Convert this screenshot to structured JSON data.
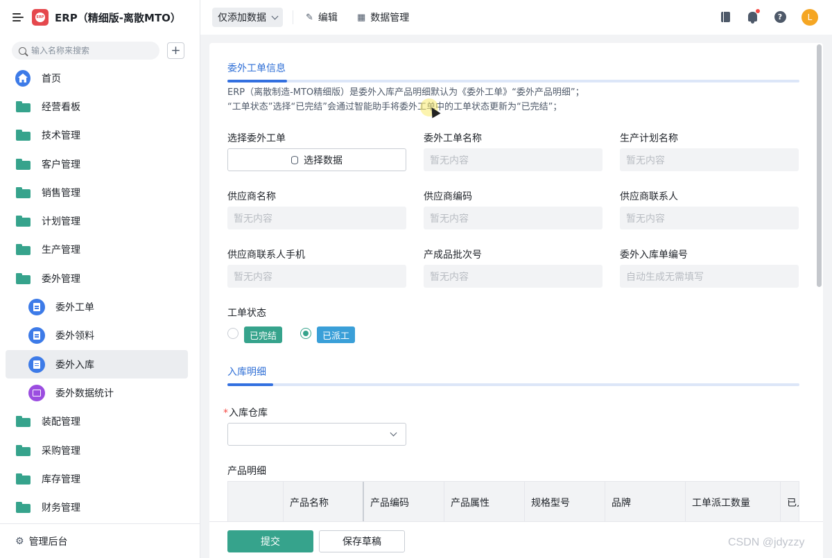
{
  "app": {
    "title": "ERP（精细版-离散MTO）",
    "logo_text": "ERP"
  },
  "sidebar": {
    "search_placeholder": "输入名称来搜索",
    "items": [
      {
        "label": "首页",
        "icon": "home-icon",
        "type": "home"
      },
      {
        "label": "经营看板",
        "icon": "folder-icon",
        "type": "folder"
      },
      {
        "label": "技术管理",
        "icon": "folder-icon",
        "type": "folder"
      },
      {
        "label": "客户管理",
        "icon": "folder-icon",
        "type": "folder"
      },
      {
        "label": "销售管理",
        "icon": "folder-icon",
        "type": "folder"
      },
      {
        "label": "计划管理",
        "icon": "folder-icon",
        "type": "folder"
      },
      {
        "label": "生产管理",
        "icon": "folder-icon",
        "type": "folder"
      },
      {
        "label": "委外管理",
        "icon": "folder-open-icon",
        "type": "folder"
      },
      {
        "label": "委外工单",
        "icon": "form-icon",
        "type": "sub"
      },
      {
        "label": "委外领料",
        "icon": "form-icon",
        "type": "sub"
      },
      {
        "label": "委外入库",
        "icon": "form-icon",
        "type": "sub",
        "active": true
      },
      {
        "label": "委外数据统计",
        "icon": "dashboard-icon",
        "type": "sub-purple"
      },
      {
        "label": "装配管理",
        "icon": "folder-icon",
        "type": "folder"
      },
      {
        "label": "采购管理",
        "icon": "folder-icon",
        "type": "folder"
      },
      {
        "label": "库存管理",
        "icon": "folder-icon",
        "type": "folder"
      },
      {
        "label": "财务管理",
        "icon": "folder-icon",
        "type": "folder"
      }
    ],
    "footer_label": "管理后台"
  },
  "topbar": {
    "mode_label": "仅添加数据",
    "edit_label": "编辑",
    "data_manage_label": "数据管理"
  },
  "form": {
    "section1_title": "委外工单信息",
    "desc_line1": "ERP（离散制造-MTO精细版）是委外入库产品明细默认为《委外工单》“委外产品明细”；",
    "desc_line2": "“工单状态”选择“已完结”会通过智能助手将委外工单中的工单状态更新为“已完结”；",
    "fields": {
      "select_order": {
        "label": "选择委外工单",
        "button": "选择数据"
      },
      "order_name": {
        "label": "委外工单名称",
        "value": "暂无内容"
      },
      "plan_name": {
        "label": "生产计划名称",
        "value": "暂无内容"
      },
      "supplier_name": {
        "label": "供应商名称",
        "value": "暂无内容"
      },
      "supplier_code": {
        "label": "供应商编码",
        "value": "暂无内容"
      },
      "supplier_contact": {
        "label": "供应商联系人",
        "value": "暂无内容"
      },
      "contact_phone": {
        "label": "供应商联系人手机",
        "value": "暂无内容"
      },
      "batch_no": {
        "label": "产成品批次号",
        "value": "暂无内容"
      },
      "receipt_no": {
        "label": "委外入库单编号",
        "value": "自动生成无需填写"
      }
    },
    "status": {
      "label": "工单状态",
      "options": [
        {
          "label": "已完结",
          "color": "#36a38c",
          "checked": false
        },
        {
          "label": "已派工",
          "color": "#3a9fd8",
          "checked": true
        }
      ]
    },
    "section2_title": "入库明细",
    "warehouse_label": "入库仓库",
    "warehouse_value": "",
    "product_detail_label": "产品明细",
    "table_headers": [
      "产品名称",
      "产品编码",
      "产品属性",
      "规格型号",
      "品牌",
      "工单派工数量",
      "已入"
    ]
  },
  "actions": {
    "submit": "提交",
    "save_draft": "保存草稿"
  },
  "watermark": "CSDN @jdyzzy",
  "colors": {
    "primary": "#36a38c",
    "accent_blue": "#3370e0",
    "nav_blue": "#3d7be8"
  }
}
